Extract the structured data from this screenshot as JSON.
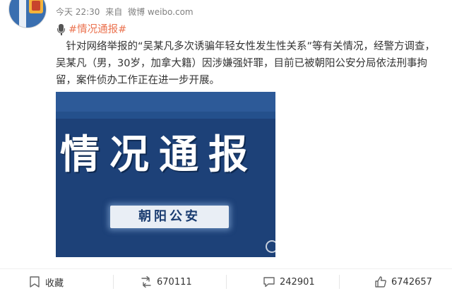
{
  "post": {
    "time": "今天 22:30",
    "source_prefix": "来自",
    "source": "微博 weibo.com",
    "topic": "#情况通报#",
    "text": "针对网络举报的“吴某凡多次诱骗年轻女性发生性关系”等有关情况，经警方调查，吴某凡（男，30岁，加拿大籍）因涉嫌强奸罪，目前已被朝阳公安分局依法刑事拘留，案件侦办工作正在进一步开展。"
  },
  "image": {
    "headline": "情况通报",
    "badge": "朝阳公安"
  },
  "actions": {
    "favorite_label": "收藏",
    "repost_count": "670111",
    "comment_count": "242901",
    "like_count": "6742657"
  },
  "colors": {
    "topic": "#eb7350",
    "image_bg": "#1d4178",
    "meta": "#808080"
  },
  "icons": [
    "avatar",
    "microphone-icon",
    "favorite-icon",
    "repost-icon",
    "comment-icon",
    "like-icon"
  ]
}
